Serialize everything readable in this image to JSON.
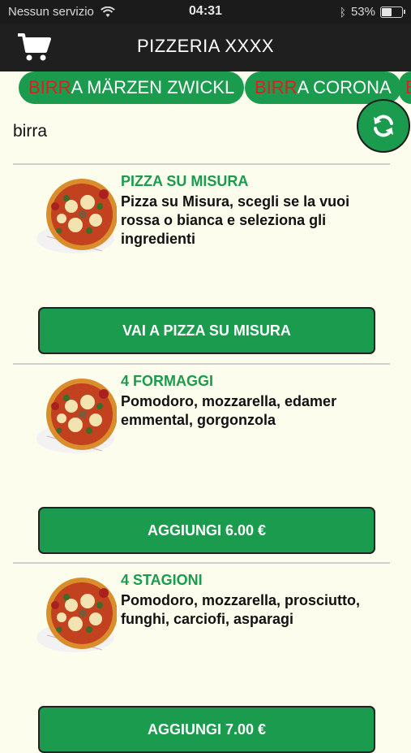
{
  "status_bar": {
    "carrier": "Nessun servizio",
    "time": "04:31",
    "battery_percent": "53%",
    "battery_level": 0.53
  },
  "header": {
    "title": "PIZZERIA XXXX"
  },
  "suggestions": [
    {
      "highlight": "BIRR",
      "rest": "A MÄRZEN ZWICKL"
    },
    {
      "highlight": "BIRR",
      "rest": "A CORONA"
    },
    {
      "highlight": "B",
      "rest": ""
    }
  ],
  "search": {
    "query": "birra"
  },
  "colors": {
    "accent": "#1a9b4d",
    "highlight": "#e21d1d",
    "background": "#fdfdee",
    "header": "#1f1f1f"
  },
  "products": [
    {
      "name": "PIZZA SU MISURA",
      "description": "Pizza su Misura, scegli se la vuoi rossa o bianca e seleziona gli ingredienti",
      "button": "VAI A PIZZA SU MISURA"
    },
    {
      "name": "4 FORMAGGI",
      "description": "Pomodoro, mozzarella, edamer emmental, gorgonzola",
      "button": "AGGIUNGI 6.00 €"
    },
    {
      "name": "4 STAGIONI",
      "description": "Pomodoro, mozzarella, prosciutto, funghi, carciofi, asparagi",
      "button": "AGGIUNGI 7.00 €"
    }
  ]
}
